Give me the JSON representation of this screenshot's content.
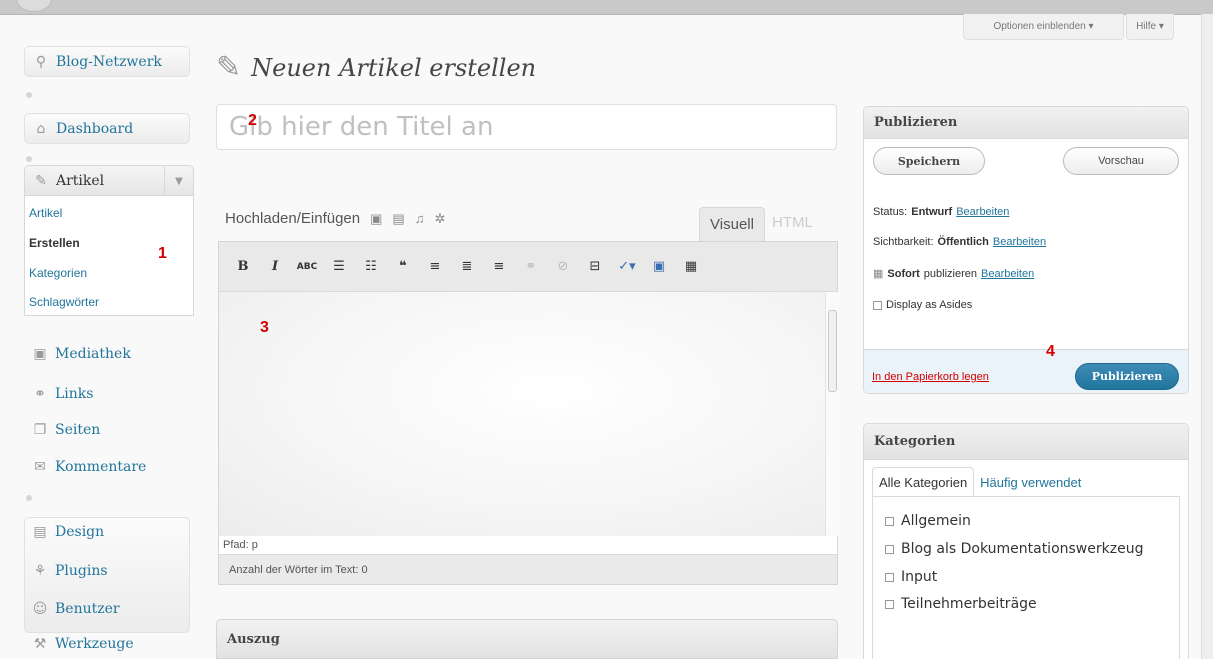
{
  "sidebar": {
    "blog_network": "Blog-Netzwerk",
    "dashboard": "Dashboard",
    "artikel": "Artikel",
    "submenu": [
      "Artikel",
      "Erstellen",
      "Kategorien",
      "Schlagwörter"
    ],
    "items": [
      "Mediathek",
      "Links",
      "Seiten",
      "Kommentare"
    ],
    "items2": [
      "Design",
      "Plugins",
      "Benutzer",
      "Werkzeuge"
    ]
  },
  "markers": {
    "m1": "1",
    "m2": "2",
    "m3": "3",
    "m4": "4"
  },
  "header": {
    "title": "Neuen Artikel erstellen",
    "screen_options": "Optionen einblenden",
    "help": "Hilfe"
  },
  "editor": {
    "title_placeholder": "Gib hier den Titel an",
    "upload_label": "Hochladen/Einfügen",
    "tab_visual": "Visuell",
    "tab_html": "HTML",
    "path": "Pfad: p",
    "word_count": "Anzahl der Wörter im Text: 0"
  },
  "excerpt": {
    "title": "Auszug"
  },
  "publish": {
    "title": "Publizieren",
    "save": "Speichern",
    "preview": "Vorschau",
    "status_label": "Status:",
    "status_value": "Entwurf",
    "visibility_label": "Sichtbarkeit:",
    "visibility_value": "Öffentlich",
    "schedule_value": "Sofort",
    "schedule_label": "publizieren",
    "edit": "Bearbeiten",
    "asides": "Display as Asides",
    "trash": "In den Papierkorb legen",
    "publish_btn": "Publizieren"
  },
  "categories": {
    "title": "Kategorien",
    "tab_all": "Alle Kategorien",
    "tab_popular": "Häufig verwendet",
    "items": [
      "Allgemein",
      "Blog als Dokumentationswerkzeug",
      "Input",
      "Teilnehmerbeiträge"
    ]
  }
}
